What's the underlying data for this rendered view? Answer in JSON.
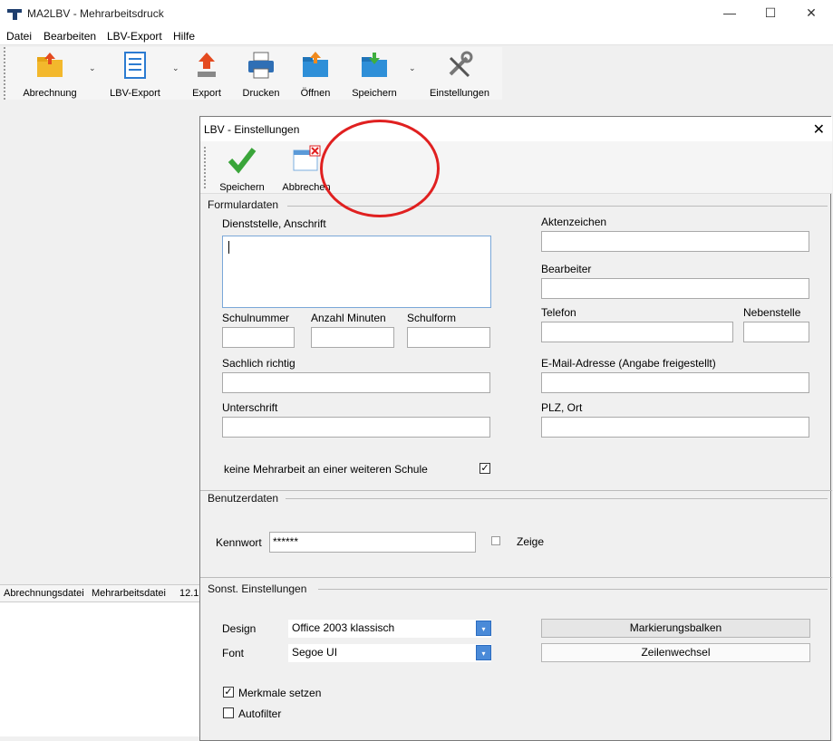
{
  "app": {
    "title": "MA2LBV - Mehrarbeitsdruck",
    "window_controls": [
      "—",
      "☐",
      "✕"
    ]
  },
  "menu": [
    "Datei",
    "Bearbeiten",
    "LBV-Export",
    "Hilfe"
  ],
  "toolbar": {
    "items": [
      "Abrechnung",
      "LBV-Export",
      "Export",
      "Drucken",
      "Öffnen",
      "Speichern",
      "Einstellungen"
    ],
    "dropdown_glyph": "⌄"
  },
  "statusbar": {
    "items": [
      "Abrechnungsdatei",
      "Mehrarbeitsdatei",
      "12.1"
    ]
  },
  "dialog": {
    "title": "LBV - Einstellungen",
    "close": "✕",
    "toolbar": {
      "save": "Speichern",
      "cancel": "Abbrechen"
    },
    "formular": {
      "heading": "Formulardaten",
      "dienststelle_label": "Dienststelle, Anschrift",
      "schulnummer_label": "Schulnummer",
      "anzahl_minuten_label": "Anzahl Minuten",
      "schulform_label": "Schulform",
      "sachlich_label": "Sachlich richtig",
      "unterschrift_label": "Unterschrift",
      "aktenzeichen_label": "Aktenzeichen",
      "bearbeiter_label": "Bearbeiter",
      "telefon_label": "Telefon",
      "nebenstelle_label": "Nebenstelle",
      "email_label": "E-Mail-Adresse (Angabe freigestellt)",
      "plz_label": "PLZ, Ort",
      "keine_mehrarbeit_label": "keine Mehrarbeit an einer weiteren Schule",
      "keine_mehrarbeit_checked": "✓"
    },
    "benutzer": {
      "heading": "Benutzerdaten",
      "kennwort_label": "Kennwort",
      "kennwort_value": "******",
      "zeige_label": "Zeige"
    },
    "sonst": {
      "heading": "Sonst. Einstellungen",
      "design_label": "Design",
      "design_value": "Office 2003 klassisch",
      "font_label": "Font",
      "font_value": "Segoe UI",
      "combo_arrow": "▾",
      "markierungsbalken": "Markierungsbalken",
      "zeilenwechsel": "Zeilenwechsel",
      "merkmale_label": "Merkmale setzen",
      "merkmale_checked": "✓",
      "autofilter_label": "Autofilter"
    }
  }
}
